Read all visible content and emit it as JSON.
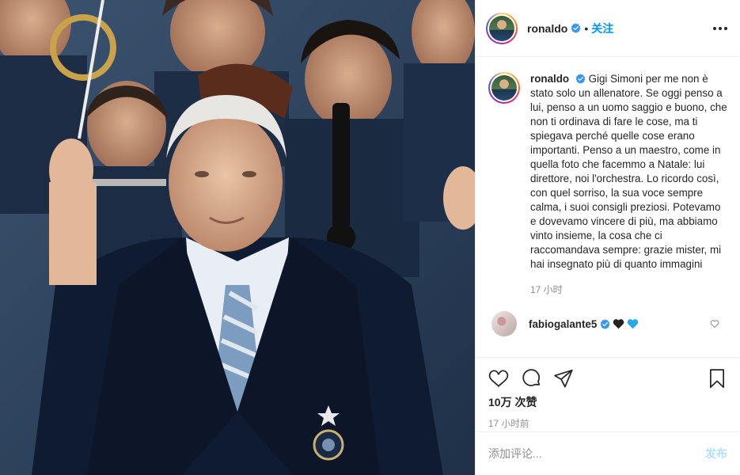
{
  "post": {
    "username": "ronaldo",
    "verified": true,
    "separator": "•",
    "follow_label": "关注"
  },
  "caption": {
    "username": "ronaldo",
    "text": "Gigi Simoni per me non è stato solo un allenatore. Se oggi penso a lui, penso a un uomo saggio e buono, che non ti ordinava di fare le cose, ma ti spiegava perché quelle cose erano importanti. Penso a un maestro, come in quella foto che facemmo a Natale: lui direttore, noi l'orchestra. Lo ricordo così, con quel sorriso, la sua voce sempre calma, i suoi consigli preziosi. Potevamo e dovevamo vincere di più, ma abbiamo vinto insieme, la cosa che ci raccomandava sempre: grazie mister, mi hai insegnato più di quanto immagini",
    "time": "17 小时"
  },
  "comment": {
    "username": "fabiogalante5",
    "verified": true,
    "emojis": [
      "black-heart",
      "blue-heart"
    ]
  },
  "actions": {
    "icons": [
      "heart-icon",
      "comment-icon",
      "share-icon",
      "bookmark-icon"
    ],
    "likes": "10万 次赞",
    "time": "17 小时前"
  },
  "composer": {
    "placeholder": "添加评论...",
    "post_label": "发布"
  },
  "colors": {
    "accent": "#0095f6",
    "accent_disabled": "#b2dffc",
    "verified": "#3897f0",
    "muted": "#8e8e8e",
    "text": "#262626"
  }
}
